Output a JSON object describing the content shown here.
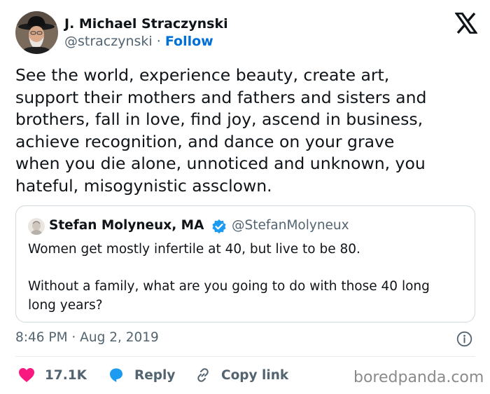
{
  "author": {
    "name": "J. Michael Straczynski",
    "handle": "@straczynski",
    "separator": "·",
    "follow_label": "Follow",
    "avatar_icon": "profile-photo-man-hat"
  },
  "platform_logo": "x-logo",
  "tweet": {
    "text": "See the world, experience beauty, create art,\nsupport their mothers and fathers and sisters and\nbrothers, fall in love, find joy, ascend in business,\nachieve recognition, and dance on your grave\nwhen you die alone, unnoticed and unknown, you\nhateful, misogynistic assclown."
  },
  "quoted_tweet": {
    "name": "Stefan Molyneux, MA",
    "handle": "@StefanMolyneux",
    "verified": true,
    "verified_color": "#1d9bf0",
    "text": "Women get mostly infertile at 40, but live to be 80.\n\nWithout a family, what are you going to do with those 40 long\nlong years?"
  },
  "timestamp": "8:46 PM · Aug 2, 2019",
  "actions": {
    "likes_count": "17.1K",
    "reply_label": "Reply",
    "copy_link_label": "Copy link",
    "like_color": "#f91880",
    "reply_color": "#1d9bf0"
  },
  "watermark": "boredpanda.com"
}
